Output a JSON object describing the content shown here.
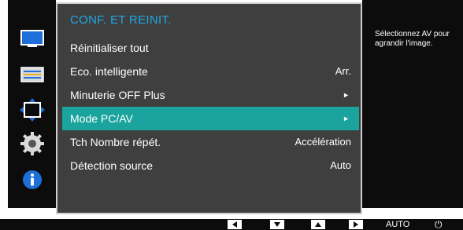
{
  "panel": {
    "title": "CONF. ET REINIT.",
    "items": [
      {
        "label": "Réinitialiser tout",
        "value": "",
        "arrow": ""
      },
      {
        "label": "Eco. intelligente",
        "value": "Arr.",
        "arrow": ""
      },
      {
        "label": "Minuterie OFF Plus",
        "value": "",
        "arrow": "►"
      },
      {
        "label": "Mode PC/AV",
        "value": "",
        "arrow": "►"
      },
      {
        "label": "Tch Nombre répét.",
        "value": "Accélération",
        "arrow": ""
      },
      {
        "label": "Détection source",
        "value": "Auto",
        "arrow": ""
      }
    ],
    "selected_index": 3
  },
  "info": {
    "text": "Sélectionnez AV pour agrandir l'image."
  },
  "sidebar": {
    "icons": [
      "monitor-icon",
      "settings-bars-icon",
      "resize-arrows-icon",
      "gear-icon",
      "info-icon"
    ]
  },
  "bottombar": {
    "buttons": [
      "left-arrow-icon",
      "down-arrow-icon",
      "up-arrow-icon",
      "right-arrow-icon"
    ],
    "auto_label": "AUTO",
    "power_symbol": "⏻"
  },
  "colors": {
    "accent": "#1ba39d",
    "title": "#1fa7e8",
    "panel": "#3f3f3f",
    "background": "#0c0c0c"
  }
}
